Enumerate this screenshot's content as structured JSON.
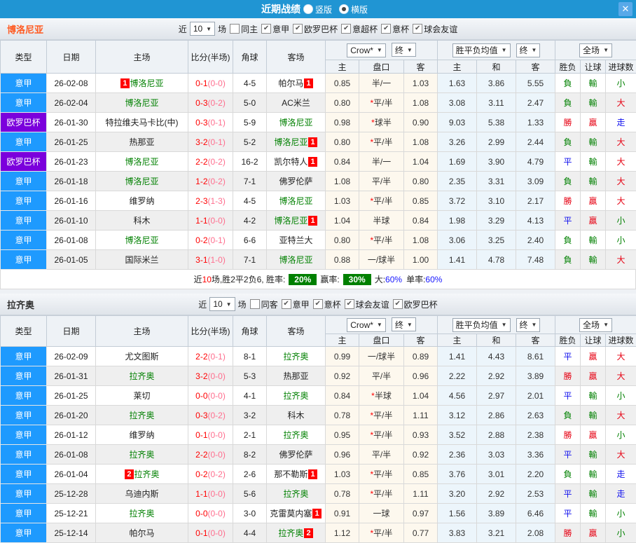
{
  "titlebar": {
    "title": "近期战绩",
    "radios": [
      {
        "label": "竖版",
        "selected": false
      },
      {
        "label": "横版",
        "selected": true
      }
    ],
    "close_label": "X",
    "bar_color": "#2095d3"
  },
  "header": {
    "type": "类型",
    "date": "日期",
    "home": "主场",
    "score": "比分(半场)",
    "corner": "角球",
    "away": "客场",
    "odds_select": "Crow*",
    "odds_final": "终",
    "europe_select": "胜平负均值",
    "europe_final": "终",
    "scope_select": "全场",
    "sub": [
      "主",
      "盘口",
      "客",
      "主",
      "和",
      "客",
      "胜负",
      "让球",
      "进球数"
    ]
  },
  "league_colors": {
    "意甲": "#1e9afe",
    "欧罗巴杯": "#7b00dc"
  },
  "result_colors": {
    "勝": "#e60012",
    "平": "#0f0fee",
    "負": "#008000",
    "贏": "#e60012",
    "輸": "#008000",
    "大": "#e60012",
    "小": "#008000",
    "走": "#0f0fee"
  },
  "sections": [
    {
      "team": "博洛尼亚",
      "team_color": "#ff5a21",
      "filter": {
        "near": "近",
        "count": "10",
        "games": "场",
        "same": {
          "label": "同主",
          "checked": false
        },
        "leagues": [
          {
            "label": "意甲",
            "checked": true
          },
          {
            "label": "欧罗巴杯",
            "checked": true
          },
          {
            "label": "意超杯",
            "checked": true
          },
          {
            "label": "意杯",
            "checked": true
          },
          {
            "label": "球会友谊",
            "checked": true
          }
        ]
      },
      "rows": [
        {
          "league": "意甲",
          "date": "26-02-08",
          "home": {
            "name": "博洛尼亚",
            "self": true,
            "badge_before": "1"
          },
          "ft": "0-1",
          "ht": "(0-0)",
          "corner": "4-5",
          "away": {
            "name": "帕尔马",
            "self": false,
            "badge_after": "1"
          },
          "o_home": "0.85",
          "o_line": "半/一",
          "o_away": "1.03",
          "e_home": "1.63",
          "e_draw": "3.86",
          "e_away": "5.55",
          "r1": "負",
          "r2": "輸",
          "r3": "小"
        },
        {
          "league": "意甲",
          "date": "26-02-04",
          "home": {
            "name": "博洛尼亚",
            "self": true
          },
          "ft": "0-3",
          "ht": "(0-2)",
          "corner": "5-0",
          "away": {
            "name": "AC米兰",
            "self": false
          },
          "o_home": "0.80",
          "o_line": "*平/半",
          "o_away": "1.08",
          "e_home": "3.08",
          "e_draw": "3.11",
          "e_away": "2.47",
          "r1": "負",
          "r2": "輸",
          "r3": "大"
        },
        {
          "league": "欧罗巴杯",
          "date": "26-01-30",
          "home": {
            "name": "特拉维夫马卡比(中)",
            "self": false
          },
          "ft": "0-3",
          "ht": "(0-1)",
          "corner": "5-9",
          "away": {
            "name": "博洛尼亚",
            "self": true
          },
          "o_home": "0.98",
          "o_line": "*球半",
          "o_away": "0.90",
          "e_home": "9.03",
          "e_draw": "5.38",
          "e_away": "1.33",
          "r1": "勝",
          "r2": "贏",
          "r3": "走"
        },
        {
          "league": "意甲",
          "date": "26-01-25",
          "home": {
            "name": "热那亚",
            "self": false
          },
          "ft": "3-2",
          "ht": "(0-1)",
          "corner": "5-2",
          "away": {
            "name": "博洛尼亚",
            "self": true,
            "badge_after": "1"
          },
          "o_home": "0.80",
          "o_line": "*平/半",
          "o_away": "1.08",
          "e_home": "3.26",
          "e_draw": "2.99",
          "e_away": "2.44",
          "r1": "負",
          "r2": "輸",
          "r3": "大"
        },
        {
          "league": "欧罗巴杯",
          "date": "26-01-23",
          "home": {
            "name": "博洛尼亚",
            "self": true
          },
          "ft": "2-2",
          "ht": "(0-2)",
          "corner": "16-2",
          "away": {
            "name": "凯尔特人",
            "self": false,
            "badge_after": "1"
          },
          "o_home": "0.84",
          "o_line": "半/一",
          "o_away": "1.04",
          "e_home": "1.69",
          "e_draw": "3.90",
          "e_away": "4.79",
          "r1": "平",
          "r2": "輸",
          "r3": "大"
        },
        {
          "league": "意甲",
          "date": "26-01-18",
          "home": {
            "name": "博洛尼亚",
            "self": true
          },
          "ft": "1-2",
          "ht": "(0-2)",
          "corner": "7-1",
          "away": {
            "name": "佛罗伦萨",
            "self": false
          },
          "o_home": "1.08",
          "o_line": "平/半",
          "o_away": "0.80",
          "e_home": "2.35",
          "e_draw": "3.31",
          "e_away": "3.09",
          "r1": "負",
          "r2": "輸",
          "r3": "大"
        },
        {
          "league": "意甲",
          "date": "26-01-16",
          "home": {
            "name": "维罗纳",
            "self": false
          },
          "ft": "2-3",
          "ht": "(1-3)",
          "corner": "4-5",
          "away": {
            "name": "博洛尼亚",
            "self": true
          },
          "o_home": "1.03",
          "o_line": "*平/半",
          "o_away": "0.85",
          "e_home": "3.72",
          "e_draw": "3.10",
          "e_away": "2.17",
          "r1": "勝",
          "r2": "贏",
          "r3": "大"
        },
        {
          "league": "意甲",
          "date": "26-01-10",
          "home": {
            "name": "科木",
            "self": false
          },
          "ft": "1-1",
          "ht": "(0-0)",
          "corner": "4-2",
          "away": {
            "name": "博洛尼亚",
            "self": true,
            "badge_after": "1"
          },
          "o_home": "1.04",
          "o_line": "半球",
          "o_away": "0.84",
          "e_home": "1.98",
          "e_draw": "3.29",
          "e_away": "4.13",
          "r1": "平",
          "r2": "贏",
          "r3": "小"
        },
        {
          "league": "意甲",
          "date": "26-01-08",
          "home": {
            "name": "博洛尼亚",
            "self": true
          },
          "ft": "0-2",
          "ht": "(0-1)",
          "corner": "6-6",
          "away": {
            "name": "亚特兰大",
            "self": false
          },
          "o_home": "0.80",
          "o_line": "*平/半",
          "o_away": "1.08",
          "e_home": "3.06",
          "e_draw": "3.25",
          "e_away": "2.40",
          "r1": "負",
          "r2": "輸",
          "r3": "小"
        },
        {
          "league": "意甲",
          "date": "26-01-05",
          "home": {
            "name": "国际米兰",
            "self": false
          },
          "ft": "3-1",
          "ht": "(1-0)",
          "corner": "7-1",
          "away": {
            "name": "博洛尼亚",
            "self": true
          },
          "o_home": "0.88",
          "o_line": "一/球半",
          "o_away": "1.00",
          "e_home": "1.41",
          "e_draw": "4.78",
          "e_away": "7.48",
          "r1": "負",
          "r2": "輸",
          "r3": "大"
        }
      ],
      "summary": {
        "near": "近",
        "count": "10",
        "seg1": "场,胜2平2负6, 胜率:",
        "win_rate": "20%",
        "seg2": "赢率:",
        "handicap_rate": "30%",
        "seg3": "大:",
        "big_rate": "60%",
        "seg4": "单率:",
        "single_rate": "60%"
      }
    },
    {
      "team": "拉齐奥",
      "team_color": "#333333",
      "filter": {
        "near": "近",
        "count": "10",
        "games": "场",
        "same": {
          "label": "同客",
          "checked": false
        },
        "leagues": [
          {
            "label": "意甲",
            "checked": true
          },
          {
            "label": "意杯",
            "checked": true
          },
          {
            "label": "球会友谊",
            "checked": true
          },
          {
            "label": "欧罗巴杯",
            "checked": true
          }
        ]
      },
      "rows": [
        {
          "league": "意甲",
          "date": "26-02-09",
          "home": {
            "name": "尤文图斯",
            "self": false
          },
          "ft": "2-2",
          "ht": "(0-1)",
          "corner": "8-1",
          "away": {
            "name": "拉齐奥",
            "self": true
          },
          "o_home": "0.99",
          "o_line": "一/球半",
          "o_away": "0.89",
          "e_home": "1.41",
          "e_draw": "4.43",
          "e_away": "8.61",
          "r1": "平",
          "r2": "贏",
          "r3": "大"
        },
        {
          "league": "意甲",
          "date": "26-01-31",
          "home": {
            "name": "拉齐奥",
            "self": true
          },
          "ft": "3-2",
          "ht": "(0-0)",
          "corner": "5-3",
          "away": {
            "name": "热那亚",
            "self": false
          },
          "o_home": "0.92",
          "o_line": "平/半",
          "o_away": "0.96",
          "e_home": "2.22",
          "e_draw": "2.92",
          "e_away": "3.89",
          "r1": "勝",
          "r2": "贏",
          "r3": "大"
        },
        {
          "league": "意甲",
          "date": "26-01-25",
          "home": {
            "name": "莱切",
            "self": false
          },
          "ft": "0-0",
          "ht": "(0-0)",
          "corner": "4-1",
          "away": {
            "name": "拉齐奥",
            "self": true
          },
          "o_home": "0.84",
          "o_line": "*半球",
          "o_away": "1.04",
          "e_home": "4.56",
          "e_draw": "2.97",
          "e_away": "2.01",
          "r1": "平",
          "r2": "輸",
          "r3": "小"
        },
        {
          "league": "意甲",
          "date": "26-01-20",
          "home": {
            "name": "拉齐奥",
            "self": true
          },
          "ft": "0-3",
          "ht": "(0-2)",
          "corner": "3-2",
          "away": {
            "name": "科木",
            "self": false
          },
          "o_home": "0.78",
          "o_line": "*平/半",
          "o_away": "1.11",
          "e_home": "3.12",
          "e_draw": "2.86",
          "e_away": "2.63",
          "r1": "負",
          "r2": "輸",
          "r3": "大"
        },
        {
          "league": "意甲",
          "date": "26-01-12",
          "home": {
            "name": "维罗纳",
            "self": false
          },
          "ft": "0-1",
          "ht": "(0-0)",
          "corner": "2-1",
          "away": {
            "name": "拉齐奥",
            "self": true
          },
          "o_home": "0.95",
          "o_line": "*平/半",
          "o_away": "0.93",
          "e_home": "3.52",
          "e_draw": "2.88",
          "e_away": "2.38",
          "r1": "勝",
          "r2": "贏",
          "r3": "小"
        },
        {
          "league": "意甲",
          "date": "26-01-08",
          "home": {
            "name": "拉齐奥",
            "self": true
          },
          "ft": "2-2",
          "ht": "(0-0)",
          "corner": "8-2",
          "away": {
            "name": "佛罗伦萨",
            "self": false
          },
          "o_home": "0.96",
          "o_line": "平/半",
          "o_away": "0.92",
          "e_home": "2.36",
          "e_draw": "3.03",
          "e_away": "3.36",
          "r1": "平",
          "r2": "輸",
          "r3": "大"
        },
        {
          "league": "意甲",
          "date": "26-01-04",
          "home": {
            "name": "拉齐奥",
            "self": true,
            "badge_before": "2"
          },
          "ft": "0-2",
          "ht": "(0-2)",
          "corner": "2-6",
          "away": {
            "name": "那不勒斯",
            "self": false,
            "badge_after": "1"
          },
          "o_home": "1.03",
          "o_line": "*平/半",
          "o_away": "0.85",
          "e_home": "3.76",
          "e_draw": "3.01",
          "e_away": "2.20",
          "r1": "負",
          "r2": "輸",
          "r3": "走"
        },
        {
          "league": "意甲",
          "date": "25-12-28",
          "home": {
            "name": "乌迪内斯",
            "self": false
          },
          "ft": "1-1",
          "ht": "(0-0)",
          "corner": "5-6",
          "away": {
            "name": "拉齐奥",
            "self": true
          },
          "o_home": "0.78",
          "o_line": "*平/半",
          "o_away": "1.11",
          "e_home": "3.20",
          "e_draw": "2.92",
          "e_away": "2.53",
          "r1": "平",
          "r2": "輸",
          "r3": "走"
        },
        {
          "league": "意甲",
          "date": "25-12-21",
          "home": {
            "name": "拉齐奥",
            "self": true
          },
          "ft": "0-0",
          "ht": "(0-0)",
          "corner": "3-0",
          "away": {
            "name": "克雷莫内塞",
            "self": false,
            "badge_after": "1"
          },
          "o_home": "0.91",
          "o_line": "一球",
          "o_away": "0.97",
          "e_home": "1.56",
          "e_draw": "3.89",
          "e_away": "6.46",
          "r1": "平",
          "r2": "輸",
          "r3": "小"
        },
        {
          "league": "意甲",
          "date": "25-12-14",
          "home": {
            "name": "帕尔马",
            "self": false
          },
          "ft": "0-1",
          "ht": "(0-0)",
          "corner": "4-4",
          "away": {
            "name": "拉齐奥",
            "self": true,
            "badge_after": "2"
          },
          "o_home": "1.12",
          "o_line": "*平/半",
          "o_away": "0.77",
          "e_home": "3.83",
          "e_draw": "3.21",
          "e_away": "2.08",
          "r1": "勝",
          "r2": "贏",
          "r3": "小"
        }
      ],
      "summary": null
    }
  ]
}
